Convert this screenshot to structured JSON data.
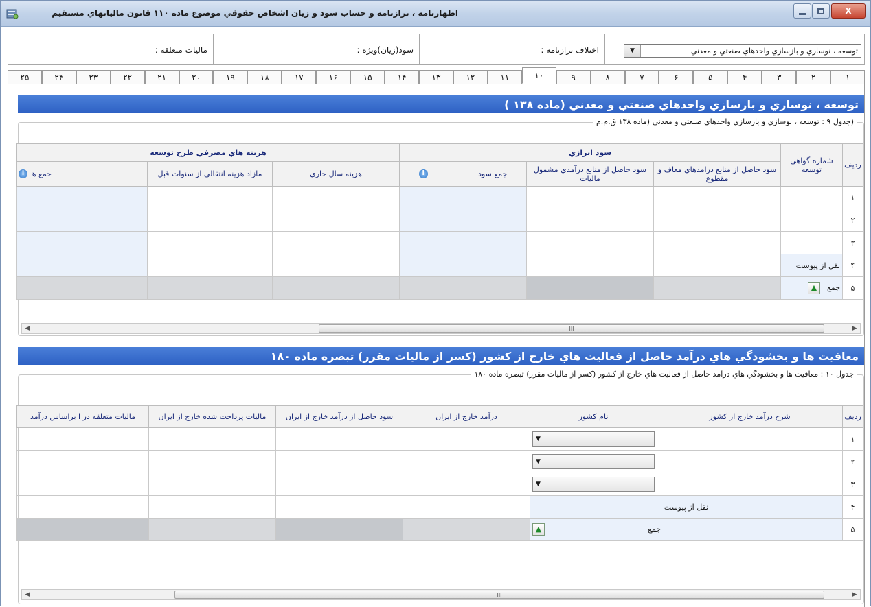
{
  "window": {
    "title": "اظهارنامه ، ترازنامه و حساب سود و زيان اشخاص حقوقي موضوع ماده ۱۱۰ قانون مالياتهاي مستقيم",
    "controls": [
      "minimize",
      "maximize",
      "close"
    ],
    "close_glyph": "X"
  },
  "topbar": {
    "activity_select": "توسعه ، نوسازي و بازسازي واحدهاي صنعتي و معدني",
    "balance_diff_label": "اختلاف ترازنامه :",
    "profit_label": "سود(زيان)ويژه :",
    "tax_label": "ماليات متعلقه :"
  },
  "tabs": [
    "۱",
    "۲",
    "۳",
    "۴",
    "۵",
    "۶",
    "۷",
    "۸",
    "۹",
    "۱۰",
    "۱۱",
    "۱۲",
    "۱۳",
    "۱۴",
    "۱۵",
    "۱۶",
    "۱۷",
    "۱۸",
    "۱۹",
    "۲۰",
    "۲۱",
    "۲۲",
    "۲۳",
    "۲۴",
    "۲۵"
  ],
  "active_tab": "۱۰",
  "section1": {
    "title": "توسعه ، نوسازي و بازسازي واحدهاي صنعتي و معدني (ماده ۱۳۸ )",
    "legend": "(جدول ۹ : توسعه ، نوسازي و بازسازي واحدهاي صنعتي و معدني (ماده ۱۳۸ ق.م.م",
    "headers": {
      "row": "رديف",
      "cert_no": "شماره گواهي توسعه",
      "group_profit": "سود ابرازي",
      "profit_exempt": "سود حاصل از منابع درامدهاي معاف و مقطوع",
      "profit_taxable": "سود حاصل از منابع درآمدي مشمول ماليات",
      "profit_total": "جمع سود",
      "group_cost": "هزينه هاي مصرفي طرح توسعه",
      "cost_current": "هزينه سال جاري",
      "cost_carried": "مازاد هزينه انتقالي از سنوات قبل",
      "cost_total": "جمع هـ"
    },
    "rows": [
      {
        "no": "۱",
        "text": ""
      },
      {
        "no": "۲",
        "text": ""
      },
      {
        "no": "۳",
        "text": ""
      },
      {
        "no": "۴",
        "text": "نقل از پيوست"
      },
      {
        "no": "۵",
        "text": "جمع"
      }
    ],
    "scroll_grip": "III"
  },
  "section2": {
    "title": "معافيت ها و بخشودگي هاي درآمد حاصل از فعاليت هاي خارج از كشور (كسر از ماليات مقرر) تبصره ماده ۱۸۰",
    "legend": "جدول ۱۰ : معافيت ها و بخشودگي هاي درآمد حاصل از فعاليت هاي خارج از كشور (كسر از ماليات مقرر) تبصره ماده ۱۸۰",
    "headers": {
      "row": "رديف",
      "desc": "شرح درآمد خارج از كشور",
      "country": "نام كشور",
      "foreign_income": "درآمد خارج از ايران",
      "profit_foreign": "سود حاصل از درآمد خارج از ايران",
      "tax_paid": "ماليات پرداخت شده خارج از ايران",
      "tax_due": "ماليات متعلقه در ا براساس درآمد"
    },
    "rows": [
      {
        "no": "۱",
        "text": ""
      },
      {
        "no": "۲",
        "text": ""
      },
      {
        "no": "۳",
        "text": ""
      },
      {
        "no": "۴",
        "text": "نقل از پيوست"
      },
      {
        "no": "۵",
        "text": "جمع"
      }
    ],
    "scroll_grip": "III"
  },
  "icons": {
    "info": "i",
    "up": "▲",
    "dropdown": "▼",
    "scroll_left": "◀",
    "scroll_right": "▶"
  }
}
